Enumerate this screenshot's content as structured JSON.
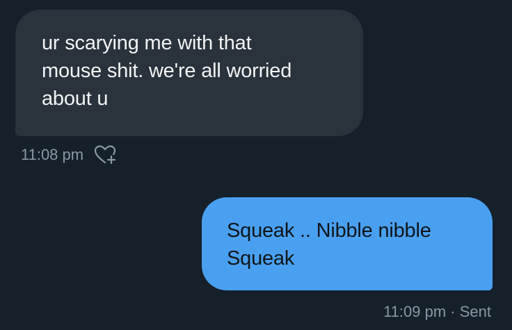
{
  "conversation": {
    "received": {
      "text": "ur scarying me with that\nmouse shit. we're all worried\nabout u",
      "time": "11:08 pm",
      "reaction_icon": "heart-plus-icon"
    },
    "sent": {
      "text": "Squeak .. Nibble nibble\nSqueak",
      "time": "11:09 pm",
      "separator": " · ",
      "status": "Sent"
    }
  },
  "colors": {
    "background": "#15202b",
    "received_bubble": "#2a323b",
    "sent_bubble": "#4aa0f0",
    "meta_text": "#8b98a5"
  }
}
